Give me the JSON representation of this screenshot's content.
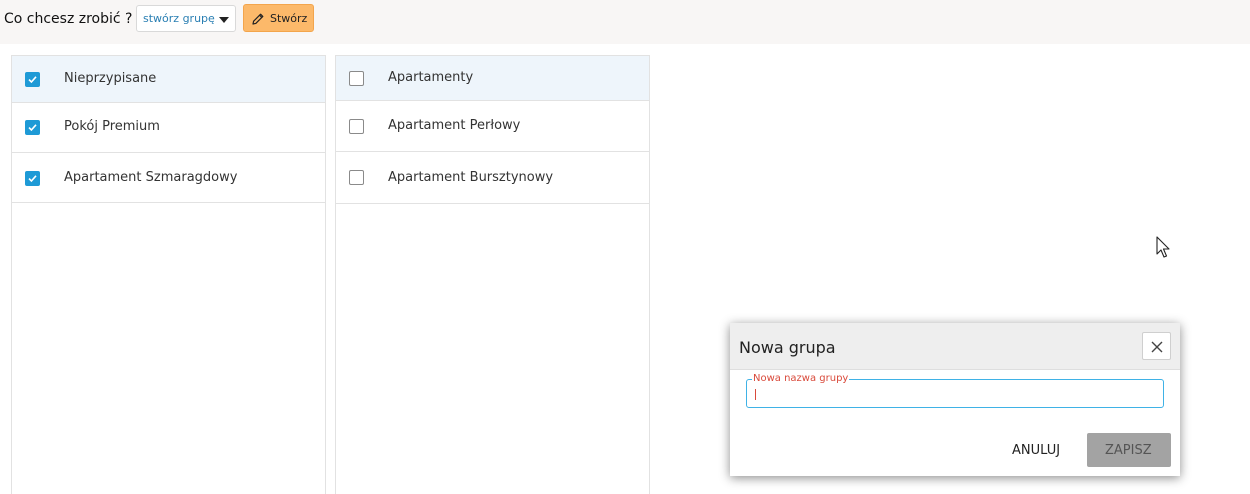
{
  "toolbar": {
    "question": "Co chcesz zrobić ?",
    "action_select_value": "stwórz grupę",
    "create_label": "Stwórz"
  },
  "left_panel": {
    "rows": [
      {
        "label": "Nieprzypisane",
        "checked": true
      },
      {
        "label": "Pokój Premium",
        "checked": true
      },
      {
        "label": "Apartament Szmaragdowy",
        "checked": true
      }
    ]
  },
  "right_panel": {
    "rows": [
      {
        "label": "Apartamenty",
        "checked": false
      },
      {
        "label": "Apartament Perłowy",
        "checked": false
      },
      {
        "label": "Apartament Bursztynowy",
        "checked": false
      }
    ]
  },
  "modal": {
    "title": "Nowa grupa",
    "field_label": "Nowa nazwa grupy",
    "field_value": "",
    "cancel_label": "ANULUJ",
    "save_label": "ZAPISZ"
  },
  "colors": {
    "accent_blue": "#1e9ad6",
    "create_button": "#fcb96a",
    "header_row": "#eef5fb",
    "field_label_red": "#d94a3b",
    "field_border": "#3fb2e6"
  },
  "icons": [
    "pencil-icon",
    "caret-down-icon",
    "checkbox-checked-icon",
    "checkbox-empty-icon",
    "close-icon",
    "mouse-pointer-icon"
  ]
}
